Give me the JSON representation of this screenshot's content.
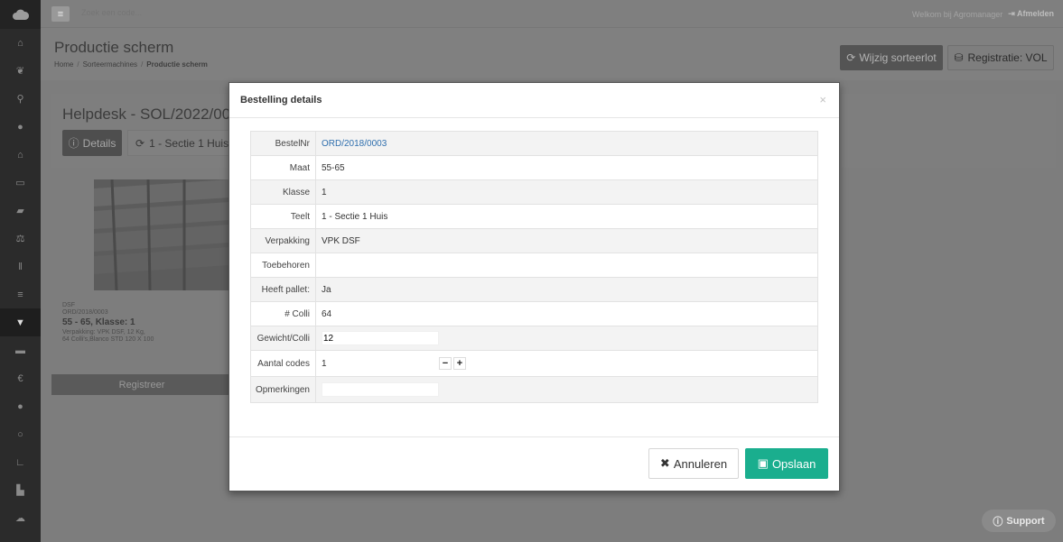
{
  "topbar": {
    "search_placeholder": "Zoek een code...",
    "welcome": "Welkom bij Agromanager",
    "logout": "Afmelden"
  },
  "header": {
    "title": "Productie scherm",
    "breadcrumb": [
      "Home",
      "Sorteermachines",
      "Productie scherm"
    ],
    "wijzig_label": "Wijzig sorteerlot",
    "registratie_label": "Registratie: VOL"
  },
  "panel": {
    "title": "Helpdesk - SOL/2022/0011",
    "details_label": "Details",
    "sectie_label": "1 - Sectie 1 Huis"
  },
  "card": {
    "line1": "DSF",
    "line2": "ORD/2018/0003",
    "headline": "55 - 65, Klasse: 1",
    "line3": "Verpakking: VPK DSF, 12 Kg,",
    "line4": "64 Colli's,Blanco STD 120 X 100",
    "registreer": "Registreer"
  },
  "support_label": "Support",
  "modal": {
    "title": "Bestelling details",
    "rows": {
      "bestelnr": {
        "label": "BestelNr",
        "value": "ORD/2018/0003"
      },
      "maat": {
        "label": "Maat",
        "value": "55-65"
      },
      "klasse": {
        "label": "Klasse",
        "value": "1"
      },
      "teelt": {
        "label": "Teelt",
        "value": "1 - Sectie 1 Huis"
      },
      "verpakking": {
        "label": "Verpakking",
        "value": "VPK DSF"
      },
      "toebehoren": {
        "label": "Toebehoren",
        "value": ""
      },
      "heeft_pallet": {
        "label": "Heeft pallet:",
        "value": "Ja"
      },
      "colli": {
        "label": "# Colli",
        "value": "64"
      },
      "gewicht": {
        "label": "Gewicht/Colli",
        "value": "12"
      },
      "aantal": {
        "label": "Aantal codes",
        "value": "1"
      },
      "opmerkingen": {
        "label": "Opmerkingen",
        "value": ""
      }
    },
    "cancel_label": "Annuleren",
    "save_label": "Opslaan"
  }
}
